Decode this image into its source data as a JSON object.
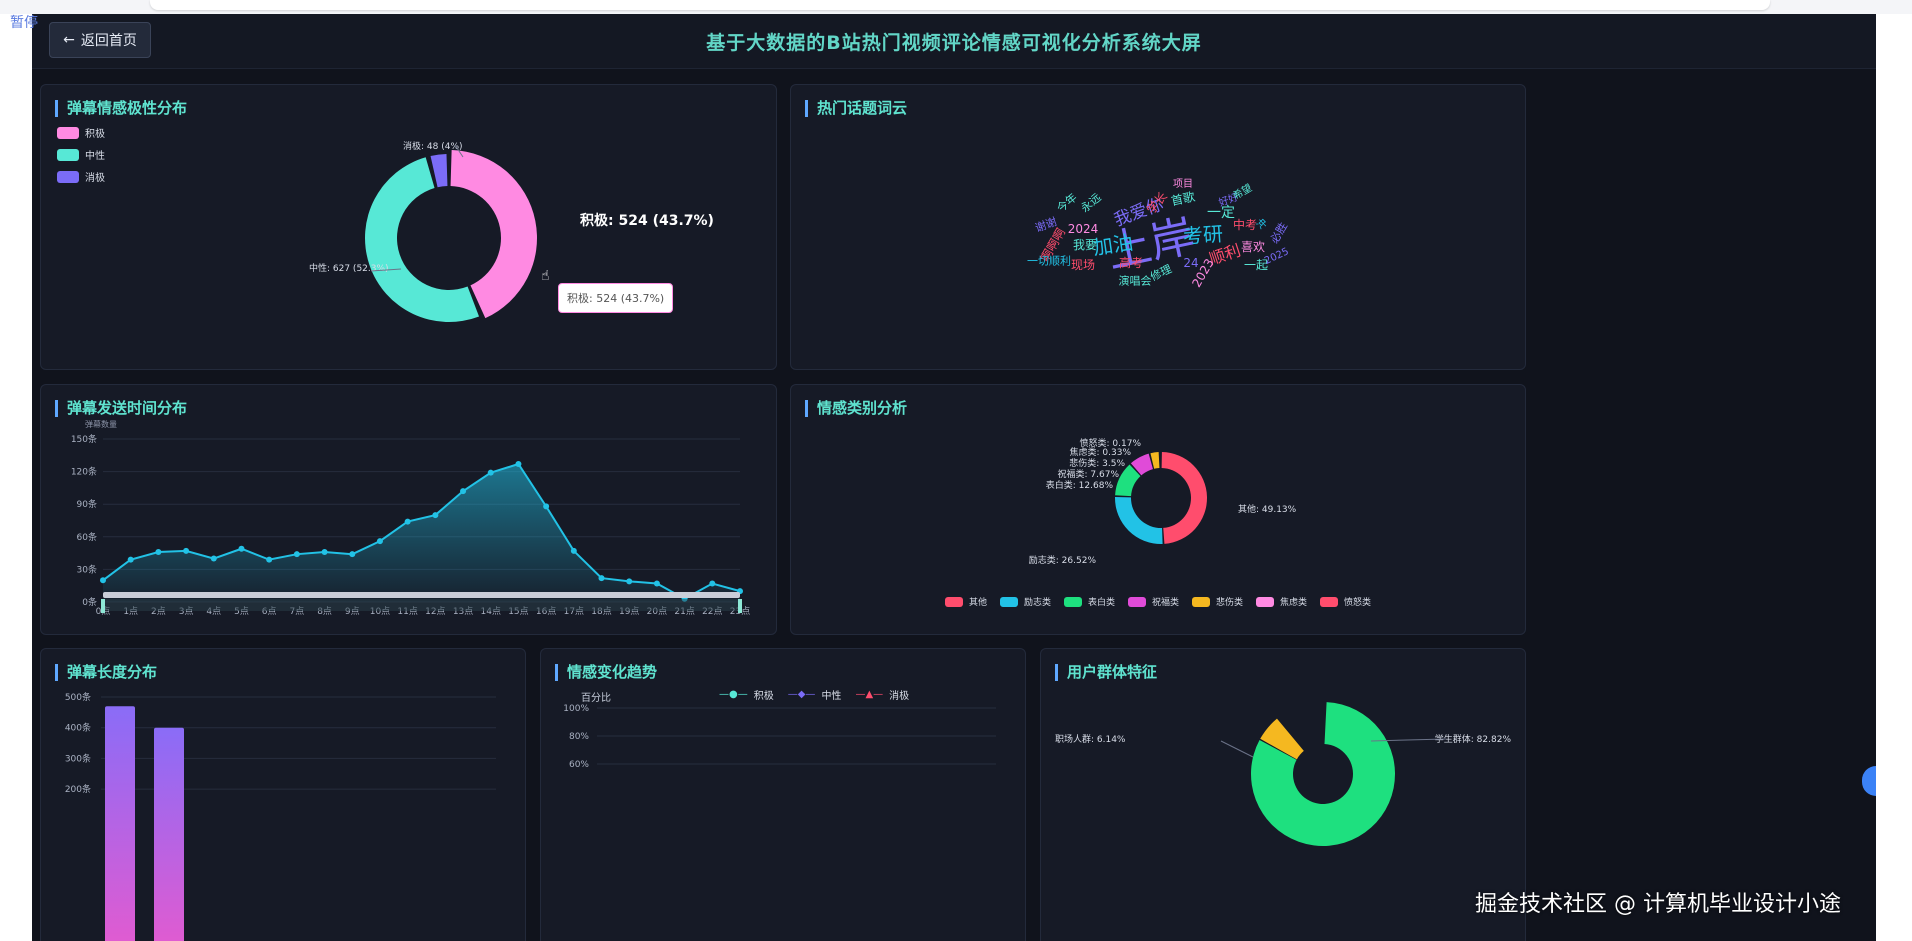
{
  "overlay": {
    "pause_label": "暂停",
    "watermark": "掘金技术社区 @ 计算机毕业设计小途"
  },
  "header": {
    "back_label": "返回首页",
    "title": "基于大数据的B站热门视频评论情感可视化分析系统大屏"
  },
  "panels": {
    "polarity": {
      "title": "弹幕情感极性分布",
      "legend": [
        "积极",
        "中性",
        "消极"
      ],
      "labels": {
        "positive": "积极: 524 (43.7%)",
        "neutral": "中性: 627 (52.3%)",
        "negative": "消极: 48 (4%)"
      },
      "tooltip": "积极: 524 (43.7%)"
    },
    "wordcloud": {
      "title": "热门话题词云"
    },
    "time": {
      "title": "弹幕发送时间分布",
      "unit_label": "弹幕数量"
    },
    "category": {
      "title": "情感类别分析",
      "labels": [
        "其他: 49.13%",
        "励志类: 26.52%",
        "表白类: 12.68%",
        "祝福类: 7.67%",
        "悲伤类: 3.5%",
        "焦虑类: 0.33%",
        "愤怒类: 0.17%"
      ],
      "legend": [
        "其他",
        "励志类",
        "表白类",
        "祝福类",
        "悲伤类",
        "焦虑类",
        "愤怒类"
      ]
    },
    "length": {
      "title": "弹幕长度分布"
    },
    "trend": {
      "title": "情感变化趋势",
      "yaxis_name": "百分比",
      "legend": [
        "积极",
        "中性",
        "消极"
      ]
    },
    "users": {
      "title": "用户群体特征",
      "labels": {
        "student": "学生群体: 82.82%",
        "worker": "职场人群: 6.14%"
      }
    }
  },
  "colors": {
    "positive": "#ff8ae2",
    "neutral": "#57e8d6",
    "negative": "#7b6cf7",
    "accent": "#5fe3cf",
    "line": "#22c2e6"
  },
  "words": [
    {
      "text": "上岸",
      "color": "#7b6cf7",
      "rot": -12
    },
    {
      "text": "加油",
      "color": "#22c2e6",
      "rot": -8
    },
    {
      "text": "考研",
      "color": "#22c2e6",
      "rot": -4
    },
    {
      "text": "我爱你",
      "color": "#7b6cf7",
      "rot": -20
    },
    {
      "text": "2024",
      "color": "#ff8ae2",
      "rot": 0
    },
    {
      "text": "一定",
      "color": "#57e8d6",
      "rot": 0
    },
    {
      "text": "顺利",
      "color": "#ff4d6d",
      "rot": -18
    },
    {
      "text": "喜欢",
      "color": "#ff8ae2",
      "rot": 0
    },
    {
      "text": "中考",
      "color": "#ff4d6d",
      "rot": 0
    },
    {
      "text": "高考",
      "color": "#ff4d6d",
      "rot": 0
    },
    {
      "text": "2023",
      "color": "#ff8ae2",
      "rot": -60
    },
    {
      "text": "24",
      "color": "#7b6cf7",
      "rot": 0
    },
    {
      "text": "首歌",
      "color": "#57e8d6",
      "rot": -12
    },
    {
      "text": "学长",
      "color": "#ff4d6d",
      "rot": -50
    },
    {
      "text": "我要",
      "color": "#57e8d6",
      "rot": 0
    },
    {
      "text": "现场",
      "color": "#ff4d6d",
      "rot": 0
    },
    {
      "text": "演唱会",
      "color": "#57e8d6",
      "rot": 0
    },
    {
      "text": "修理",
      "color": "#57e8d6",
      "rot": -25
    },
    {
      "text": "一起",
      "color": "#57e8d6",
      "rot": 0
    },
    {
      "text": "2025",
      "color": "#7b6cf7",
      "rot": -25
    },
    {
      "text": "谢谢",
      "color": "#7b6cf7",
      "rot": -20
    },
    {
      "text": "啊啊啊",
      "color": "#ff4d6d",
      "rot": -60
    },
    {
      "text": "一切顺利",
      "color": "#22c2e6",
      "rot": 0
    },
    {
      "text": "今年",
      "color": "#57e8d6",
      "rot": -40
    },
    {
      "text": "永远",
      "color": "#57e8d6",
      "rot": -40
    },
    {
      "text": "项目",
      "color": "#ff8ae2",
      "rot": 0
    },
    {
      "text": "好好",
      "color": "#7b6cf7",
      "rot": -20
    },
    {
      "text": "希望",
      "color": "#57e8d6",
      "rot": -30
    },
    {
      "text": "必胜",
      "color": "#7b6cf7",
      "rot": -60
    },
    {
      "text": "冲",
      "color": "#22c2e6",
      "rot": -45
    }
  ],
  "chart_data": [
    {
      "type": "pie",
      "title": "弹幕情感极性分布",
      "categories": [
        "积极",
        "中性",
        "消极"
      ],
      "values": [
        524,
        627,
        48
      ],
      "percents": [
        43.7,
        52.3,
        4
      ]
    },
    {
      "type": "area",
      "title": "弹幕发送时间分布",
      "ylabel": "弹幕数量",
      "categories": [
        "0点",
        "1点",
        "2点",
        "3点",
        "4点",
        "5点",
        "6点",
        "7点",
        "8点",
        "9点",
        "10点",
        "11点",
        "12点",
        "13点",
        "14点",
        "15点",
        "16点",
        "17点",
        "18点",
        "19点",
        "20点",
        "21点",
        "22点",
        "23点"
      ],
      "values": [
        20,
        39,
        46,
        47,
        40,
        49,
        39,
        44,
        46,
        44,
        56,
        74,
        80,
        102,
        119,
        127,
        88,
        47,
        22,
        19,
        17,
        3,
        17,
        10
      ],
      "ylim": [
        0,
        150
      ],
      "yticks": [
        "0条",
        "30条",
        "60条",
        "90条",
        "120条",
        "150条"
      ],
      "grid": true
    },
    {
      "type": "pie",
      "title": "情感类别分析",
      "categories": [
        "其他",
        "励志类",
        "表白类",
        "祝福类",
        "悲伤类",
        "焦虑类",
        "愤怒类"
      ],
      "values": [
        49.13,
        26.52,
        12.68,
        7.67,
        3.5,
        0.33,
        0.17
      ],
      "legend": "bottom"
    },
    {
      "type": "bar",
      "title": "弹幕长度分布",
      "values": [
        470,
        400
      ],
      "ylim": [
        0,
        500
      ],
      "yticks": [
        "200条",
        "300条",
        "400条",
        "500条"
      ]
    },
    {
      "type": "line",
      "title": "情感变化趋势",
      "ylabel": "百分比",
      "series": [
        {
          "name": "积极"
        },
        {
          "name": "中性"
        },
        {
          "name": "消极"
        }
      ],
      "yticks": [
        "60%",
        "80%",
        "100%"
      ],
      "legend": "top"
    },
    {
      "type": "pie",
      "title": "用户群体特征",
      "categories": [
        "学生群体",
        "职场人群"
      ],
      "values": [
        82.82,
        6.14
      ]
    }
  ]
}
